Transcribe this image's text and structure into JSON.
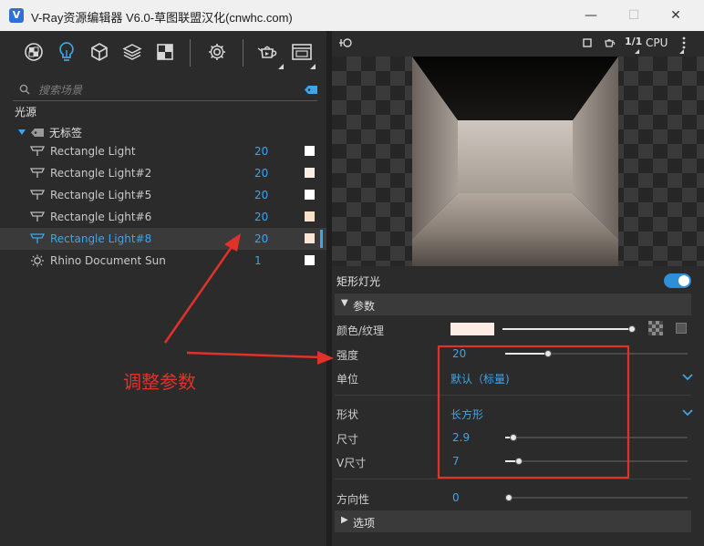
{
  "window": {
    "title": "V-Ray资源编辑器 V6.0-草图联盟汉化(cnwhc.com)",
    "logo_letter": "V",
    "min_glyph": "—",
    "max_glyph": "☐",
    "close_glyph": "✕"
  },
  "toolbar": {
    "icons": [
      "materials-icon",
      "lights-icon",
      "geometry-icon",
      "layers-icon",
      "textures-icon",
      "settings-icon",
      "render-teapot-icon",
      "frame-buffer-icon"
    ]
  },
  "search": {
    "placeholder": "搜索场景"
  },
  "outliner": {
    "section": "光源",
    "group_label": "无标签",
    "lights": [
      {
        "name": "Rectangle Light",
        "count": "20",
        "color": "#ffffff",
        "selected": false,
        "icon": "rect-light-icon"
      },
      {
        "name": "Rectangle Light#2",
        "count": "20",
        "color": "#fbefe3",
        "selected": false,
        "icon": "rect-light-icon"
      },
      {
        "name": "Rectangle Light#5",
        "count": "20",
        "color": "#ffffff",
        "selected": false,
        "icon": "rect-light-icon"
      },
      {
        "name": "Rectangle Light#6",
        "count": "20",
        "color": "#f7e1c8",
        "selected": false,
        "icon": "rect-light-icon"
      },
      {
        "name": "Rectangle Light#8",
        "count": "20",
        "color": "#fbe6d6",
        "selected": true,
        "icon": "rect-light-icon"
      },
      {
        "name": "Rhino Document Sun",
        "count": "1",
        "color": "#ffffff",
        "selected": false,
        "icon": "sun-icon"
      }
    ]
  },
  "annotation": {
    "text": "调整参数",
    "color": "#e0312b"
  },
  "preview_bar": {
    "fraction": "1/1",
    "engine": "CPU"
  },
  "properties": {
    "title": "矩形灯光",
    "enabled": true,
    "params_group": "参数",
    "color_label": "颜色/纹理",
    "color_value": "#fdece4",
    "intensity_label": "强度",
    "intensity_value": "20",
    "intensity_level": 0.23,
    "unit_label": "单位",
    "unit_value": "默认（标量)",
    "shape_label": "形状",
    "shape_value": "长方形",
    "size_label": "尺寸",
    "size_value": "2.9",
    "size_level": 0.04,
    "vsize_label": "V尺寸",
    "vsize_value": "7",
    "vsize_level": 0.07,
    "directional_label": "方向性",
    "directional_value": "0",
    "directional_level": 0.0,
    "options_group": "选项"
  },
  "colors": {
    "accent": "#3da6e8",
    "highlight_box": "#e0312b"
  }
}
